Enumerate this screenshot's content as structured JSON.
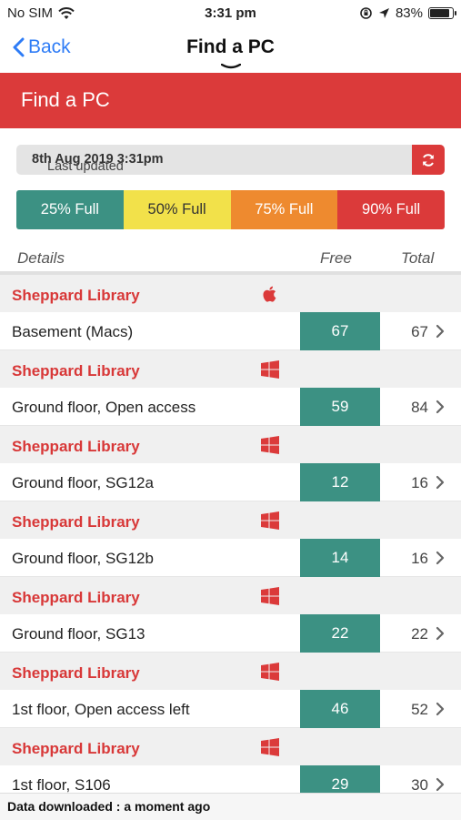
{
  "status_bar": {
    "carrier": "No SIM",
    "time": "3:31 pm",
    "battery": "83%"
  },
  "nav": {
    "back_label": "Back",
    "title": "Find a PC"
  },
  "header": {
    "title": "Find a PC"
  },
  "updated": {
    "prefix": "Last updated",
    "datetime": "8th Aug 2019 3:31pm"
  },
  "legend": [
    {
      "label": "25% Full",
      "color": "#3c9183",
      "text_color": "#ffffff"
    },
    {
      "label": "50% Full",
      "color": "#f2e14a",
      "text_color": "#333333"
    },
    {
      "label": "75% Full",
      "color": "#ee8a2f",
      "text_color": "#ffffff"
    },
    {
      "label": "90% Full",
      "color": "#db3a3a",
      "text_color": "#ffffff"
    }
  ],
  "table_header": {
    "details": "Details",
    "free": "Free",
    "total": "Total"
  },
  "rooms": [
    {
      "library": "Sheppard Library",
      "os": "apple-icon",
      "location": "Basement (Macs)",
      "free": "67",
      "total": "67"
    },
    {
      "library": "Sheppard Library",
      "os": "windows-icon",
      "location": "Ground floor, Open access",
      "free": "59",
      "total": "84"
    },
    {
      "library": "Sheppard Library",
      "os": "windows-icon",
      "location": "Ground floor, SG12a",
      "free": "12",
      "total": "16"
    },
    {
      "library": "Sheppard Library",
      "os": "windows-icon",
      "location": "Ground floor, SG12b",
      "free": "14",
      "total": "16"
    },
    {
      "library": "Sheppard Library",
      "os": "windows-icon",
      "location": "Ground floor, SG13",
      "free": "22",
      "total": "22"
    },
    {
      "library": "Sheppard Library",
      "os": "windows-icon",
      "location": "1st floor, Open access left",
      "free": "46",
      "total": "52"
    },
    {
      "library": "Sheppard Library",
      "os": "windows-icon",
      "location": "1st floor, S106",
      "free": "29",
      "total": "30"
    }
  ],
  "footer": {
    "text": "Data downloaded : a moment ago"
  },
  "colors": {
    "accent_red": "#db3a3a",
    "free_teal": "#3c9183",
    "ios_blue": "#2e7cf6"
  }
}
